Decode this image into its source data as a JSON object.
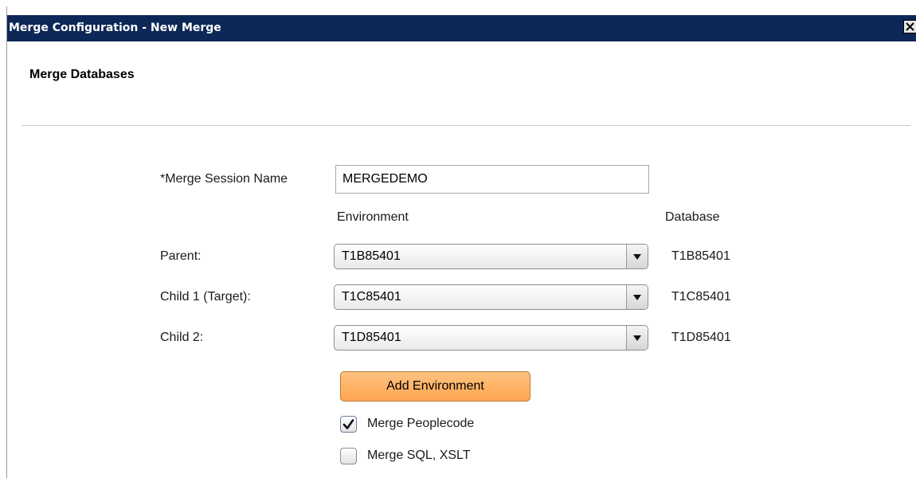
{
  "window": {
    "title": "Merge Configuration - New Merge",
    "close_icon": "close-icon"
  },
  "section": {
    "title": "Merge Databases"
  },
  "session": {
    "label": "*Merge Session Name",
    "value": "MERGEDEMO"
  },
  "columns": {
    "environment": "Environment",
    "database": "Database"
  },
  "rows": [
    {
      "label": "Parent:",
      "environment": "T1B85401",
      "database": "T1B85401"
    },
    {
      "label": "Child 1 (Target):",
      "environment": "T1C85401",
      "database": "T1C85401"
    },
    {
      "label": "Child 2:",
      "environment": "T1D85401",
      "database": "T1D85401"
    }
  ],
  "add_environment": {
    "label": "Add Environment",
    "color": "#ffb062"
  },
  "options": [
    {
      "label": "Merge Peoplecode",
      "checked": true
    },
    {
      "label": "Merge SQL, XSLT",
      "checked": false
    }
  ],
  "colors": {
    "titlebar": "#0d2757",
    "accent_button": "#ffb062"
  }
}
